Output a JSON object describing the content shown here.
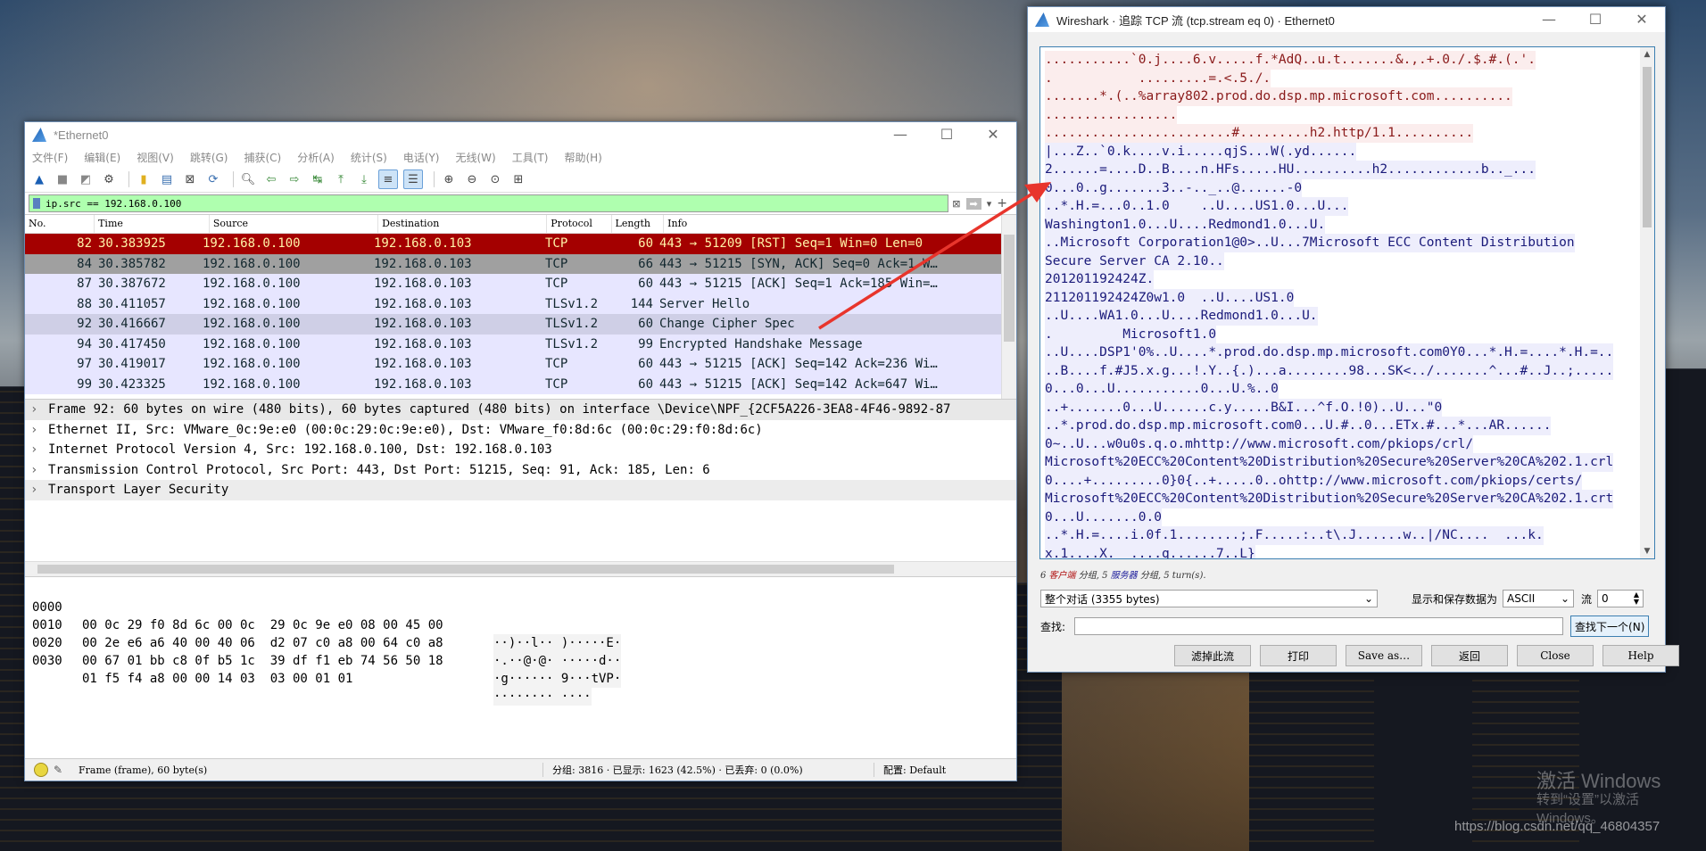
{
  "desktop": {
    "watermark_line1": "激活 Windows",
    "watermark_line2": "转到“设置”以激活 Windows。",
    "url_watermark": "https://blog.csdn.net/qq_46804357"
  },
  "main_window": {
    "title": "*Ethernet0",
    "controls": {
      "minimize": "—",
      "maximize": "☐",
      "close": "✕"
    },
    "menu": [
      "文件(F)",
      "编辑(E)",
      "视图(V)",
      "跳转(G)",
      "捕获(C)",
      "分析(A)",
      "统计(S)",
      "电话(Y)",
      "无线(W)",
      "工具(T)",
      "帮助(H)"
    ],
    "toolbar_icons": [
      "shark-fin-start-icon",
      "stop-icon",
      "restart-icon",
      "options-gear-icon",
      "open-folder-icon",
      "save-file-icon",
      "close-file-icon",
      "reload-icon",
      "find-icon",
      "back-arrow-icon",
      "forward-arrow-icon",
      "goto-packet-icon",
      "first-packet-icon",
      "last-packet-icon",
      "autoscroll-icon",
      "colorize-icon",
      "zoom-in-icon",
      "zoom-out-icon",
      "zoom-normal-icon",
      "resize-columns-icon"
    ],
    "filter": {
      "value": "ip.src == 192.168.0.100",
      "plus": "+"
    },
    "columns": [
      "No.",
      "Time",
      "Source",
      "Destination",
      "Protocol",
      "Length",
      "Info"
    ],
    "packets": [
      {
        "no": "82",
        "time": "30.383925",
        "src": "192.168.0.100",
        "dst": "192.168.0.103",
        "proto": "TCP",
        "len": "60",
        "info": "443 → 51209 [RST] Seq=1 Win=0 Len=0",
        "bg": "#a40000",
        "fg": "#fff3a8"
      },
      {
        "no": "84",
        "time": "30.385782",
        "src": "192.168.0.100",
        "dst": "192.168.0.103",
        "proto": "TCP",
        "len": "66",
        "info": "443 → 51215 [SYN, ACK] Seq=0 Ack=1 W…",
        "bg": "#a0a0a0",
        "fg": "#12272e"
      },
      {
        "no": "87",
        "time": "30.387672",
        "src": "192.168.0.100",
        "dst": "192.168.0.103",
        "proto": "TCP",
        "len": "60",
        "info": "443 → 51215 [ACK] Seq=1 Ack=185 Win=…",
        "bg": "#e7e6ff",
        "fg": "#12272e"
      },
      {
        "no": "88",
        "time": "30.411057",
        "src": "192.168.0.100",
        "dst": "192.168.0.103",
        "proto": "TLSv1.2",
        "len": "144",
        "info": "Server Hello",
        "bg": "#e7e6ff",
        "fg": "#12272e"
      },
      {
        "no": "92",
        "time": "30.416667",
        "src": "192.168.0.100",
        "dst": "192.168.0.103",
        "proto": "TLSv1.2",
        "len": "60",
        "info": "Change Cipher Spec",
        "bg": "#cfcfe6",
        "fg": "#12272e"
      },
      {
        "no": "94",
        "time": "30.417450",
        "src": "192.168.0.100",
        "dst": "192.168.0.103",
        "proto": "TLSv1.2",
        "len": "99",
        "info": "Encrypted Handshake Message",
        "bg": "#e7e6ff",
        "fg": "#12272e"
      },
      {
        "no": "97",
        "time": "30.419017",
        "src": "192.168.0.100",
        "dst": "192.168.0.103",
        "proto": "TCP",
        "len": "60",
        "info": "443 → 51215 [ACK] Seq=142 Ack=236 Wi…",
        "bg": "#e7e6ff",
        "fg": "#12272e"
      },
      {
        "no": "99",
        "time": "30.423325",
        "src": "192.168.0.100",
        "dst": "192.168.0.103",
        "proto": "TCP",
        "len": "60",
        "info": "443 → 51215 [ACK] Seq=142 Ack=647 Wi…",
        "bg": "#e7e6ff",
        "fg": "#12272e"
      }
    ],
    "details": [
      "Frame 92: 60 bytes on wire (480 bits), 60 bytes captured (480 bits) on interface \\Device\\NPF_{2CF5A226-3EA8-4F46-9892-87",
      "Ethernet II, Src: VMware_0c:9e:e0 (00:0c:29:0c:9e:e0), Dst: VMware_f0:8d:6c (00:0c:29:f0:8d:6c)",
      "Internet Protocol Version 4, Src: 192.168.0.100, Dst: 192.168.0.103",
      "Transmission Control Protocol, Src Port: 443, Dst Port: 51215, Seq: 91, Ack: 185, Len: 6",
      "Transport Layer Security"
    ],
    "bytes": [
      {
        "off": "0000",
        "hex": "00 0c 29 f0 8d 6c 00 0c  29 0c 9e e0 08 00 45 00",
        "ascii": "··)··l·· )·····E·"
      },
      {
        "off": "0010",
        "hex": "00 2e e6 a6 40 00 40 06  d2 07 c0 a8 00 64 c0 a8",
        "ascii": "·.··@·@· ·····d··"
      },
      {
        "off": "0020",
        "hex": "00 67 01 bb c8 0f b5 1c  39 df f1 eb 74 56 50 18",
        "ascii": "·g······ 9···tVP·"
      },
      {
        "off": "0030",
        "hex": "01 f5 f4 a8 00 00 14 03  03 00 01 01",
        "ascii": "········ ····"
      }
    ],
    "status": {
      "frame": "Frame (frame), 60 byte(s)",
      "packets": "分组: 3816 · 已显示: 1623 (42.5%) · 已丢弃: 0 (0.0%)",
      "profile": "配置: Default"
    }
  },
  "stream_window": {
    "title": "Wireshark · 追踪 TCP 流 (tcp.stream eq 0) · Ethernet0",
    "controls": {
      "minimize": "—",
      "maximize": "☐",
      "close": "✕"
    },
    "lines": [
      {
        "t": "...........`0.j....6.v.....f.*AdQ..u.t.......&.,.+.0./.$.#.(.'.",
        "c": "client"
      },
      {
        "t": ".           .........=.<.5./.",
        "c": "client"
      },
      {
        "t": ".......*.(..%array802.prod.do.dsp.mp.microsoft.com..........",
        "c": "client"
      },
      {
        "t": ".................",
        "c": "client"
      },
      {
        "t": "........................#.........h2.http/1.1..........",
        "c": "client"
      },
      {
        "t": "|...Z..`0.k....v.i.....qjS...W(.yd......",
        "c": "server"
      },
      {
        "t": "2......=....D..B....n.HFs.....HU..........h2............b.._...",
        "c": "server"
      },
      {
        "t": "0...0..g.......3..-.._..@......-0",
        "c": "server"
      },
      {
        "t": "..*.H.=...0..1.0    ..U....US1.0...U...",
        "c": "server"
      },
      {
        "t": "Washington1.0...U....Redmond1.0...U.",
        "c": "server"
      },
      {
        "t": "..Microsoft Corporation1@0>..U...7Microsoft ECC Content Distribution",
        "c": "server"
      },
      {
        "t": "Secure Server CA 2.10..",
        "c": "server"
      },
      {
        "t": "201201192424Z.",
        "c": "server"
      },
      {
        "t": "211201192424Z0w1.0  ..U....US1.0",
        "c": "server"
      },
      {
        "t": "..U....WA1.0...U....Redmond1.0...U.",
        "c": "server"
      },
      {
        "t": ".         Microsoft1.0",
        "c": "server"
      },
      {
        "t": "..U....DSP1'0%..U....*.prod.do.dsp.mp.microsoft.com0Y0...*.H.=....*.H.=..",
        "c": "server"
      },
      {
        "t": "..B....f.#J5.x.g...!.Y..{.)...a........98...SK<../.......^...#..J..;.....",
        "c": "server"
      },
      {
        "t": "0...0...U...........0...U.%..0",
        "c": "server"
      },
      {
        "t": "..+.......0...U......c.y.....B&I...^f.O.!0)..U...\"0",
        "c": "server"
      },
      {
        "t": "..*.prod.do.dsp.mp.microsoft.com0...U.#..0...ETx.#...*...AR......",
        "c": "server"
      },
      {
        "t": "0~..U...w0u0s.q.o.mhttp://www.microsoft.com/pkiops/crl/",
        "c": "server"
      },
      {
        "t": "Microsoft%20ECC%20Content%20Distribution%20Secure%20Server%20CA%202.1.crl",
        "c": "server"
      },
      {
        "t": "0....+.........0}0{..+.....0..ohttp://www.microsoft.com/pkiops/certs/",
        "c": "server"
      },
      {
        "t": "Microsoft%20ECC%20Content%20Distribution%20Secure%20Server%20CA%202.1.crt",
        "c": "server"
      },
      {
        "t": "0...U.......0.0",
        "c": "server"
      },
      {
        "t": "..*.H.=....i.0f.1........;.F.....:..t\\.J......w..|/NC....  ...k.",
        "c": "server"
      },
      {
        "t": "x.1....X.  ....q......7..L}",
        "c": "server"
      }
    ],
    "stats": {
      "n1": "6 ",
      "client": "客户端",
      "mid1": " 分组, ",
      "n2": "5 ",
      "server": "服务器",
      "mid2": " 分组, ",
      "turns": "5 turn(s)."
    },
    "conversation_select": "整个对话 (3355 bytes)",
    "show_as_label": "显示和保存数据为",
    "show_as_value": "ASCII",
    "stream_label": "流",
    "stream_value": "0",
    "find_label": "查找:",
    "find_value": "",
    "find_next": "查找下一个(N)",
    "buttons": [
      "滤掉此流",
      "打印",
      "Save as…",
      "返回",
      "Close",
      "Help"
    ],
    "colors": {
      "client": "#8a1a1a",
      "server": "#1a1a7a"
    }
  },
  "annotation_arrow": {
    "color": "#e8352c"
  }
}
